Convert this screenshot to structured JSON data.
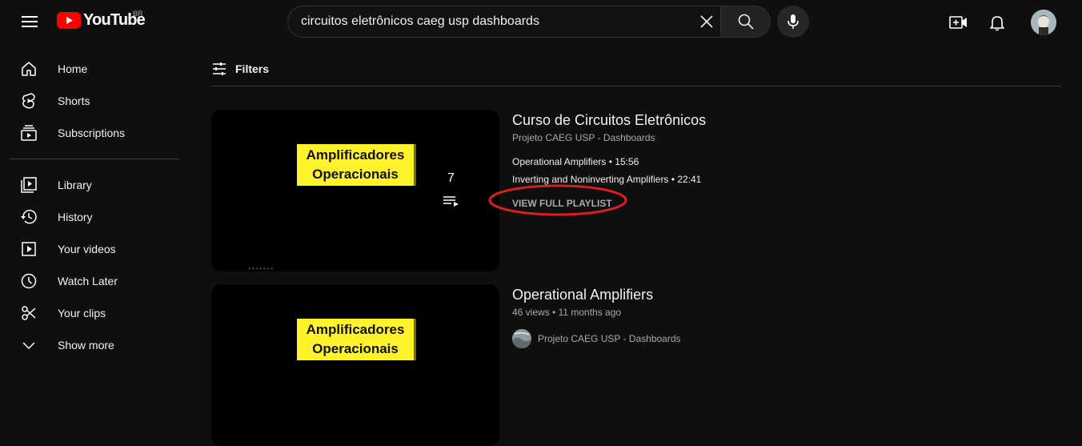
{
  "header": {
    "logo_text": "YouTube",
    "country_code": "BR",
    "search_value": "circuitos eletrônicos caeg usp dashboards",
    "brand_color": "#ff0000"
  },
  "sidebar": {
    "items": [
      {
        "label": "Home",
        "icon": "home-icon"
      },
      {
        "label": "Shorts",
        "icon": "shorts-icon"
      },
      {
        "label": "Subscriptions",
        "icon": "subscriptions-icon"
      },
      {
        "label": "Library",
        "icon": "library-icon"
      },
      {
        "label": "History",
        "icon": "history-icon"
      },
      {
        "label": "Your videos",
        "icon": "your-videos-icon"
      },
      {
        "label": "Watch Later",
        "icon": "watch-later-icon"
      },
      {
        "label": "Your clips",
        "icon": "scissors-icon"
      },
      {
        "label": "Show more",
        "icon": "chevron-down-icon"
      }
    ]
  },
  "filters": {
    "label": "Filters"
  },
  "results": [
    {
      "type": "playlist",
      "thumbnail_text": [
        "Amplificadores",
        "Operacionais"
      ],
      "video_count": "7",
      "title": "Curso de Circuitos Eletrônicos",
      "channel": "Projeto CAEG USP - Dashboards",
      "items": [
        {
          "title": "Operational Amplifiers",
          "duration": "15:56"
        },
        {
          "title": "Inverting and Noninverting Amplifiers",
          "duration": "22:41"
        }
      ],
      "view_full_label": "VIEW FULL PLAYLIST",
      "highlight_color": "#d42020"
    },
    {
      "type": "video",
      "thumbnail_text": [
        "Amplificadores",
        "Operacionais"
      ],
      "title": "Operational Amplifiers",
      "views": "46 views",
      "age": "11 months ago",
      "channel": "Projeto CAEG USP - Dashboards"
    }
  ]
}
